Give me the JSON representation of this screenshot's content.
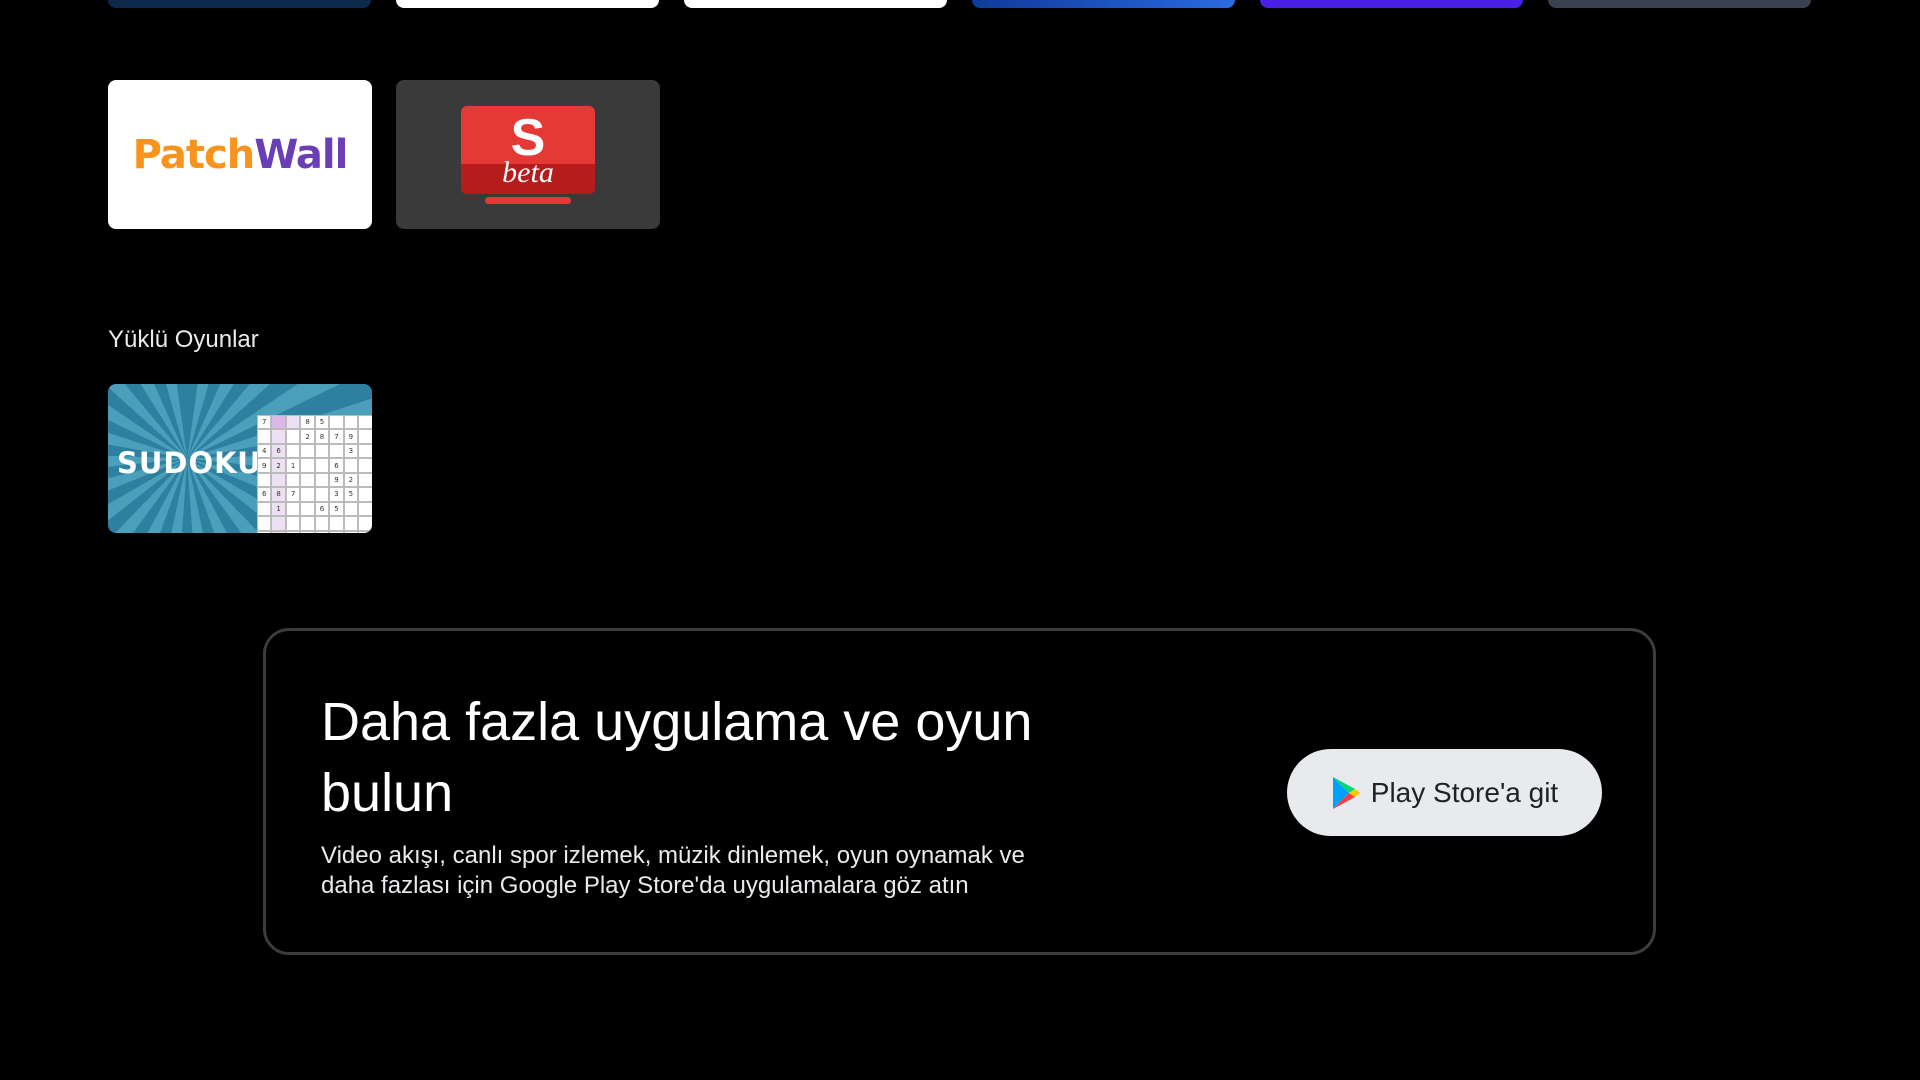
{
  "top_row_tiles": [
    {
      "name": "app-tile-1",
      "color": "#0d2a4d"
    },
    {
      "name": "app-tile-2",
      "color": "#ffffff"
    },
    {
      "name": "app-tile-3",
      "color": "#ffffff"
    },
    {
      "name": "app-tile-4",
      "color": "#1e56c4"
    },
    {
      "name": "app-tile-5",
      "color": "#4a1fe6"
    },
    {
      "name": "app-tile-6",
      "color": "#3a4250"
    }
  ],
  "apps": {
    "patchwall": {
      "logo_part1": "Patch",
      "logo_part2": "Wall"
    },
    "s_beta": {
      "letter": "S",
      "word": "beta"
    }
  },
  "games_section": {
    "title": "Yüklü Oyunlar",
    "sudoku": {
      "label": "SUDOKU"
    }
  },
  "promo": {
    "heading": "Daha fazla uygulama ve oyun bulun",
    "body": "Video akışı, canlı spor izlemek, müzik dinlemek, oyun oynamak ve daha fazlası için Google Play Store'da uygulamalara göz atın",
    "button_label": "Play Store'a git",
    "button_icon": "play-store-icon"
  }
}
